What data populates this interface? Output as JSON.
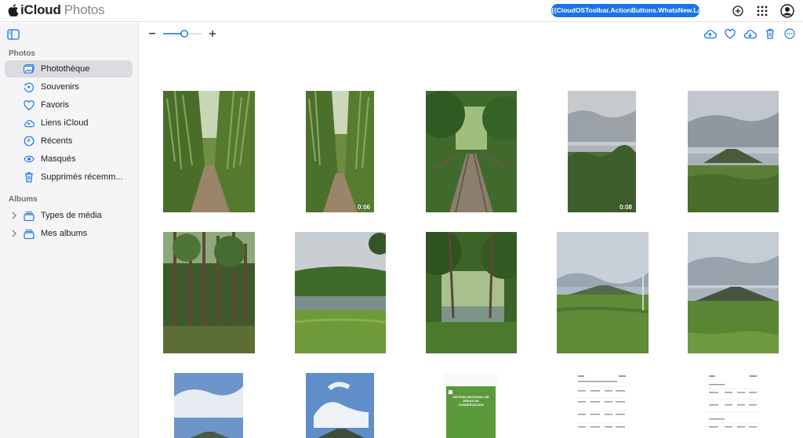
{
  "app": {
    "brand": "iCloud",
    "product": "Photos"
  },
  "toolbar": {
    "whats_new_label": "{{CloudOSToolbar.ActionButtons.WhatsNew.Label}}"
  },
  "sidebar": {
    "section_photos": "Photos",
    "section_albums": "Albums",
    "items": [
      {
        "label": "Photothèque",
        "icon": "library-icon"
      },
      {
        "label": "Souvenirs",
        "icon": "memories-icon"
      },
      {
        "label": "Favoris",
        "icon": "heart-icon"
      },
      {
        "label": "Liens iCloud",
        "icon": "cloud-link-icon"
      },
      {
        "label": "Récents",
        "icon": "clock-icon"
      },
      {
        "label": "Masqués",
        "icon": "eye-icon"
      },
      {
        "label": "Supprimés récemm...",
        "icon": "trash-icon"
      }
    ],
    "albums": [
      {
        "label": "Types de média",
        "icon": "stack-icon"
      },
      {
        "label": "Mes albums",
        "icon": "stack-icon"
      }
    ]
  },
  "zoom": {
    "level": 0.55
  },
  "photos": {
    "durations": [
      "0:06",
      "0:08"
    ],
    "doc_title": "SISTEMA NACIONAL DE ÁREAS DE CONSERVACIÓN"
  },
  "colors": {
    "accent": "#1a73e8",
    "sidebar_bg": "#f5f5f7",
    "active_row": "#dcdce0"
  }
}
